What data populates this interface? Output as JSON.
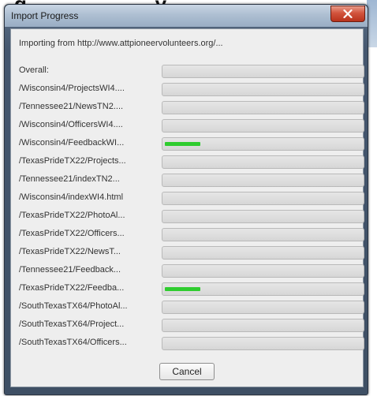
{
  "window": {
    "title": "Import Progress",
    "source_text": "Importing from http://www.attpioneervolunteers.org/...",
    "close_icon": "close-icon"
  },
  "progress": {
    "overall_label": "Overall:",
    "overall_fraction": 0,
    "items": [
      {
        "label": "/Wisconsin4/ProjectsWI4....",
        "fraction": 0
      },
      {
        "label": "/Tennessee21/NewsTN2....",
        "fraction": 0
      },
      {
        "label": "/Wisconsin4/OfficersWI4....",
        "fraction": 0
      },
      {
        "label": "/Wisconsin4/FeedbackWI...",
        "fraction": 0.18
      },
      {
        "label": "/TexasPrideTX22/Projects...",
        "fraction": 0
      },
      {
        "label": "/Tennessee21/indexTN2...",
        "fraction": 0
      },
      {
        "label": "/Wisconsin4/indexWI4.html",
        "fraction": 0
      },
      {
        "label": "/TexasPrideTX22/PhotoAl...",
        "fraction": 0
      },
      {
        "label": "/TexasPrideTX22/Officers...",
        "fraction": 0
      },
      {
        "label": "/TexasPrideTX22/NewsT...",
        "fraction": 0
      },
      {
        "label": "/Tennessee21/Feedback...",
        "fraction": 0
      },
      {
        "label": "/TexasPrideTX22/Feedba...",
        "fraction": 0.18
      },
      {
        "label": "/SouthTexasTX64/PhotoAl...",
        "fraction": 0
      },
      {
        "label": "/SouthTexasTX64/Project...",
        "fraction": 0
      },
      {
        "label": "/SouthTexasTX64/Officers...",
        "fraction": 0
      }
    ]
  },
  "buttons": {
    "cancel_label": "Cancel"
  },
  "colors": {
    "progress_fill": "#2fcc2f",
    "close_button": "#c9432b"
  }
}
